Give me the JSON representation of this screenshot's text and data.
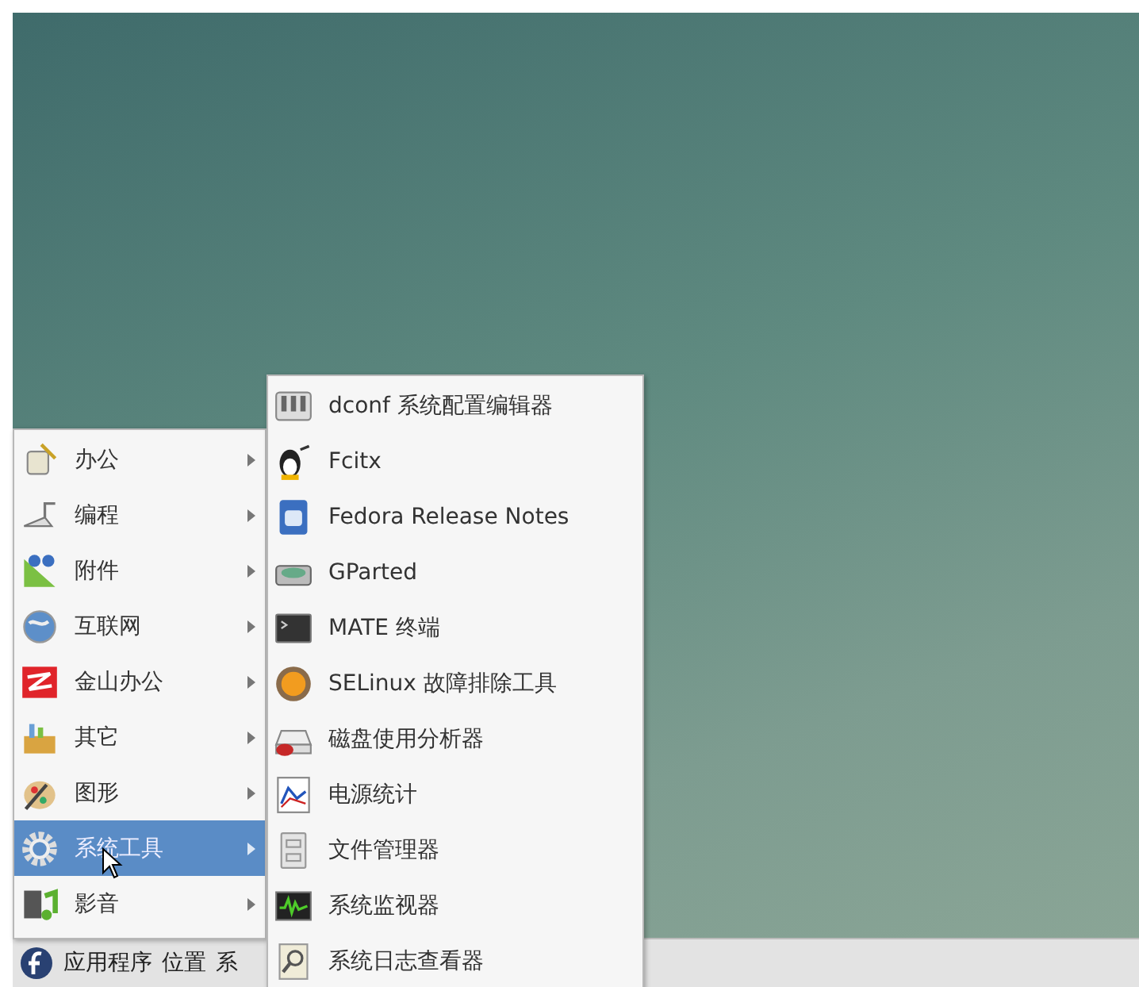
{
  "main_menu": {
    "items": [
      {
        "label": "办公",
        "selected": false
      },
      {
        "label": "编程",
        "selected": false
      },
      {
        "label": "附件",
        "selected": false
      },
      {
        "label": "互联网",
        "selected": false
      },
      {
        "label": "金山办公",
        "selected": false
      },
      {
        "label": "其它",
        "selected": false
      },
      {
        "label": "图形",
        "selected": false
      },
      {
        "label": "系统工具",
        "selected": true
      },
      {
        "label": "影音",
        "selected": false
      }
    ]
  },
  "submenu": {
    "items": [
      {
        "label": "dconf 系统配置编辑器"
      },
      {
        "label": "Fcitx"
      },
      {
        "label": "Fedora Release Notes"
      },
      {
        "label": "GParted"
      },
      {
        "label": "MATE 终端"
      },
      {
        "label": "SELinux 故障排除工具"
      },
      {
        "label": "磁盘使用分析器"
      },
      {
        "label": "电源统计"
      },
      {
        "label": "文件管理器"
      },
      {
        "label": "系统监视器"
      },
      {
        "label": "系统日志查看器"
      }
    ]
  },
  "panel": {
    "items": [
      "应用程序",
      "位置",
      "系"
    ]
  }
}
